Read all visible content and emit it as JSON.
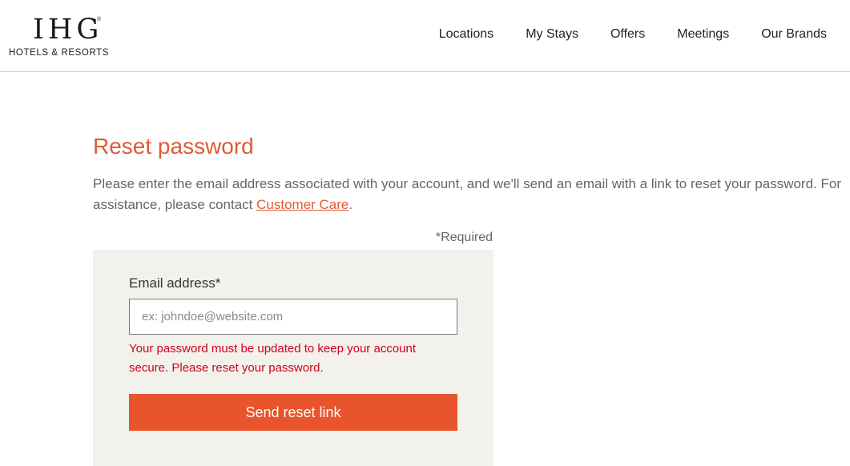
{
  "header": {
    "logo": {
      "mark": "IHG",
      "registered": "®",
      "subtitle": "HOTELS & RESORTS"
    },
    "nav": [
      {
        "label": "Locations"
      },
      {
        "label": "My Stays"
      },
      {
        "label": "Offers"
      },
      {
        "label": "Meetings"
      },
      {
        "label": "Our Brands"
      }
    ]
  },
  "main": {
    "title": "Reset password",
    "intro_before_link": "Please enter the email address associated with your account, and we'll send an email with a link to reset your password. For assistance, please contact ",
    "intro_link": "Customer Care",
    "intro_after_link": ".",
    "required_note": "*Required",
    "form": {
      "email_label": "Email address*",
      "email_value": "",
      "email_placeholder": "ex: johndoe@website.com",
      "error_message": "Your password must be updated to keep your account secure. Please reset your password.",
      "submit_label": "Send reset link"
    }
  },
  "colors": {
    "accent": "#e05a35",
    "button": "#e8542b",
    "error": "#d0021b",
    "panel": "#f3f1ec"
  }
}
